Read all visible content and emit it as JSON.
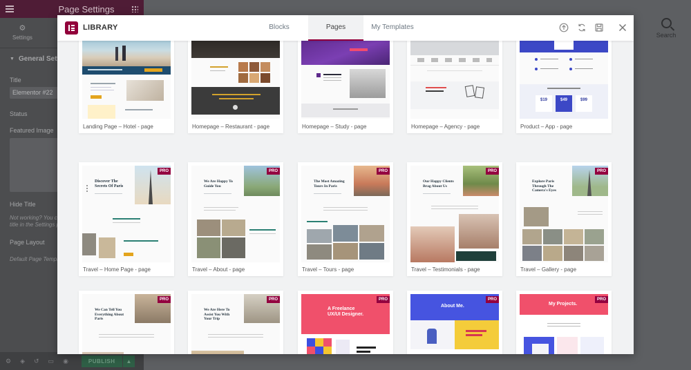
{
  "panel": {
    "title": "Page Settings",
    "tab_settings": "Settings",
    "section_title": "General Setti",
    "title_label": "Title",
    "title_value": "Elementor #22",
    "status_label": "Status",
    "featured_label": "Featured Image",
    "hide_title_label": "Hide Title",
    "hide_title_note": "Not working? You can\ntitle in the Settings p",
    "page_layout_label": "Page Layout",
    "page_layout_note": "Default Page Templa",
    "publish_label": "PUBLISH"
  },
  "search": {
    "label": "Search"
  },
  "library": {
    "title": "LIBRARY",
    "tabs": [
      {
        "label": "Blocks",
        "active": false
      },
      {
        "label": "Pages",
        "active": true
      },
      {
        "label": "My Templates",
        "active": false
      }
    ],
    "icons": [
      "upload-icon",
      "sync-icon",
      "save-icon",
      "close-icon"
    ],
    "pro_badge": "PRO",
    "cards": [
      {
        "label": "Landing Page – Hotel - page",
        "pro": false
      },
      {
        "label": "Homepage – Restaurant - page",
        "pro": false
      },
      {
        "label": "Homepage – Study - page",
        "pro": false
      },
      {
        "label": "Homepage – Agency - page",
        "pro": false
      },
      {
        "label": "Product – App - page",
        "pro": false
      },
      {
        "label": "Travel – Home Page - page",
        "pro": true,
        "heading": "Discover The\nSecrets Of Paris"
      },
      {
        "label": "Travel – About - page",
        "pro": true,
        "heading": "We Are Happy To\nGuide You"
      },
      {
        "label": "Travel – Tours - page",
        "pro": true,
        "heading": "The Most Amazing\nTours In Paris"
      },
      {
        "label": "Travel – Testimonials - page",
        "pro": true,
        "heading": "Our Happy Clients\nBrag About Us"
      },
      {
        "label": "Travel – Gallery - page",
        "pro": true,
        "heading": "Explore Paris\nThrough The\nCamera's Eyes"
      },
      {
        "label": "",
        "pro": true,
        "heading": "We Can Tell You\nEverything About\nParis"
      },
      {
        "label": "",
        "pro": true,
        "heading": "We Are Here To\nAssist You With\nYour Trip"
      },
      {
        "label": "",
        "pro": true,
        "heading": "A Freelance\nUX/UI Designer."
      },
      {
        "label": "",
        "pro": true,
        "heading": "About Me."
      },
      {
        "label": "",
        "pro": true,
        "heading": "My Projects."
      }
    ]
  },
  "colors": {
    "accent": "#92003b",
    "modal_bg": "#f1f2f3",
    "panel_header": "#4f1c36"
  }
}
